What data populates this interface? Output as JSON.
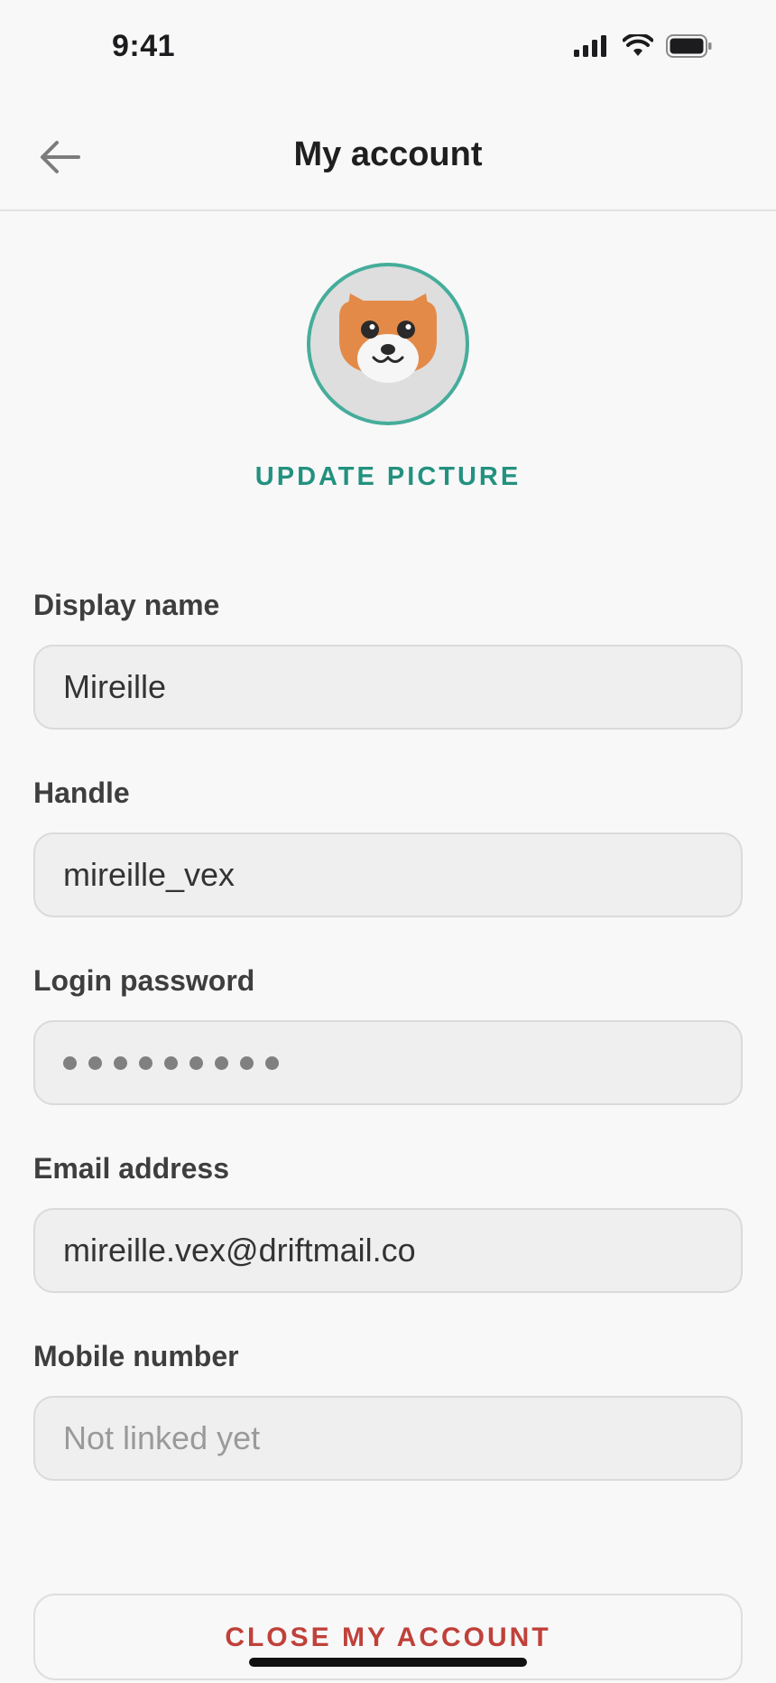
{
  "status_bar": {
    "time": "9:41",
    "icons": [
      "cellular-signal-icon",
      "wifi-icon",
      "battery-icon"
    ]
  },
  "nav": {
    "back_icon": "arrow-left-icon",
    "title": "My account"
  },
  "profile": {
    "avatar": "fox-avatar",
    "update_picture_label": "UPDATE PICTURE"
  },
  "form": {
    "display_name": {
      "label": "Display name",
      "value": "Mireille"
    },
    "handle": {
      "label": "Handle",
      "value": "mireille_vex"
    },
    "password": {
      "label": "Login password",
      "masked_length": 9
    },
    "email": {
      "label": "Email address",
      "value": "mireille.vex@driftmail.co"
    },
    "mobile": {
      "label": "Mobile number",
      "placeholder": "Not linked yet",
      "value": ""
    }
  },
  "actions": {
    "close_account_label": "CLOSE MY ACCOUNT"
  },
  "colors": {
    "accent": "#23917f",
    "avatar_ring": "#45ad9b",
    "danger": "#c0413a",
    "background": "#f8f8f8",
    "field_background": "#efefef"
  }
}
